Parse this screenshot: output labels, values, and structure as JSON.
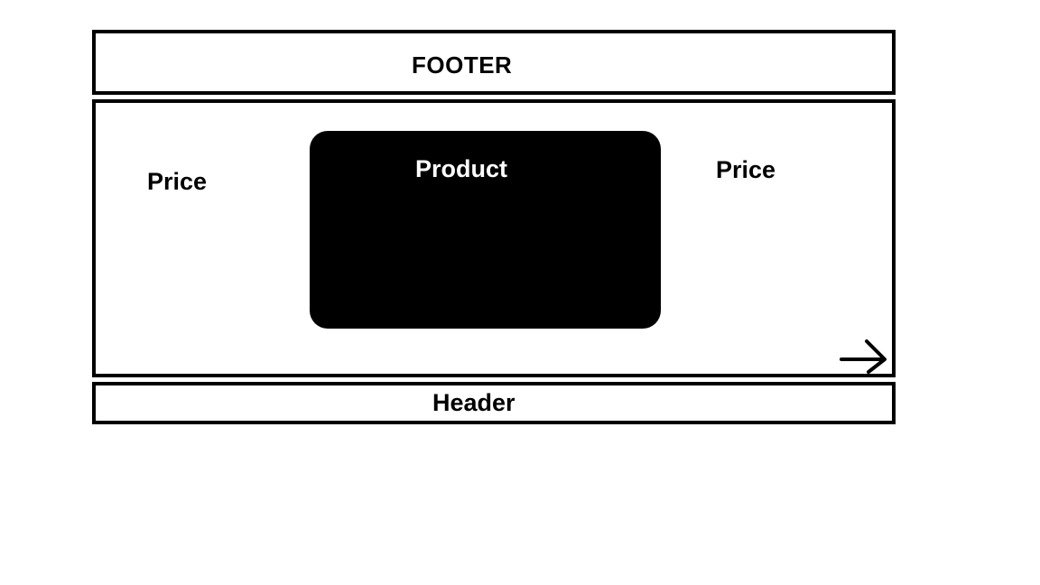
{
  "footer": {
    "label": "FOOTER"
  },
  "main": {
    "price_left": "Price",
    "product_label": "Product",
    "price_right": "Price",
    "arrow_icon": "arrow-right-icon"
  },
  "header": {
    "label": "Header"
  },
  "colors": {
    "stroke": "#000000",
    "background": "#ffffff",
    "product_fill": "#000000",
    "product_text": "#ffffff"
  }
}
